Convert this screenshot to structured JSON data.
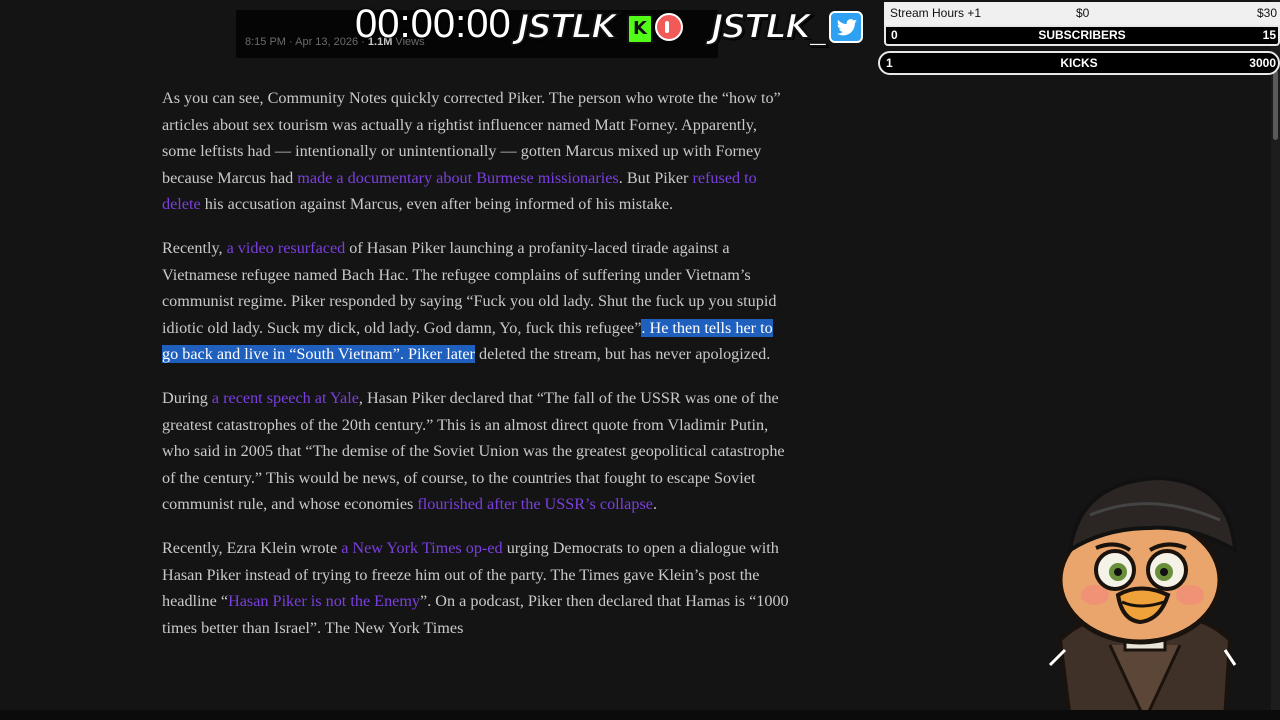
{
  "tweet": {
    "time": "8:15 PM · Apr 13, 2026 · ",
    "views_count": "1.1M",
    "views_label": " Views"
  },
  "stream": {
    "timer": "00:00:00",
    "logo_text": "JSTLK",
    "logo_text_2": "JSTLK",
    "kick_letter": "K",
    "twitter_suffix": "_"
  },
  "goals": {
    "stream_hours": {
      "label": "Stream Hours +1",
      "current": "$0",
      "goal": "$30"
    },
    "subscribers": {
      "count": "0",
      "label": "SUBSCRIBERS",
      "goal": "15"
    },
    "kicks": {
      "count": "1",
      "label": "KICKS",
      "goal": "3000"
    }
  },
  "article": {
    "p1": {
      "t1": "As you can see, Community Notes quickly corrected Piker. The person who wrote the “how to” articles about sex tourism was actually a rightist influencer named Matt Forney. Apparently, some leftists had — intentionally or unintentionally — gotten Marcus mixed up with Forney because Marcus had ",
      "l1": "made a documentary about Burmese missionaries",
      "t2": ". But Piker ",
      "l2": "refused to delete",
      "t3": " his accusation against Marcus, even after being informed of his mistake."
    },
    "p2": {
      "t1": "Recently, ",
      "l1": "a video resurfaced",
      "t2": " of Hasan Piker launching a profanity-laced tirade against a Vietnamese refugee named Bach Hac. The refugee complains of suffering under Vietnam’s communist regime. Piker responded by saying “Fuck you old lady. Shut the fuck up you stupid idiotic old lady. Suck my dick, old lady. God damn, Yo, fuck this refugee”",
      "highlight": ". He then tells her to go back and live in “South Vietnam”. Piker later",
      "t3": " deleted the stream, but has never apologized."
    },
    "p3": {
      "t1": "During ",
      "l1": "a recent speech at Yale",
      "t2": ", Hasan Piker declared that “The fall of the USSR was one of the greatest catastrophes of the 20th century.” This is an almost direct quote from Vladimir Putin, who said in 2005 that “The demise of the Soviet Union was the greatest geopolitical catastrophe of the century.” This would be news, of course, to the countries that fought to escape Soviet communist rule, and whose economies ",
      "l2": "flourished after the USSR’s collapse",
      "t3": "."
    },
    "p4": {
      "t1": "Recently, Ezra Klein wrote ",
      "l1": "a New York Times op-ed",
      "t2": " urging Democrats to open a dialogue with Hasan Piker instead of trying to freeze him out of the party. The Times gave Klein’s post the headline “",
      "l2": "Hasan Piker is not the Enemy",
      "t3": "”. On a podcast, Piker then declared that Hamas is “1000 times better than Israel”. The New York Times"
    }
  },
  "colors": {
    "link": "#7b3fe0",
    "highlight": "#1f5fbe",
    "kick_green": "#53fc18",
    "twitter_blue": "#2ea1f2"
  },
  "icons": [
    "kick-logo-icon",
    "record-icon",
    "twitter-bird-icon",
    "streamer-penguin-avatar"
  ]
}
